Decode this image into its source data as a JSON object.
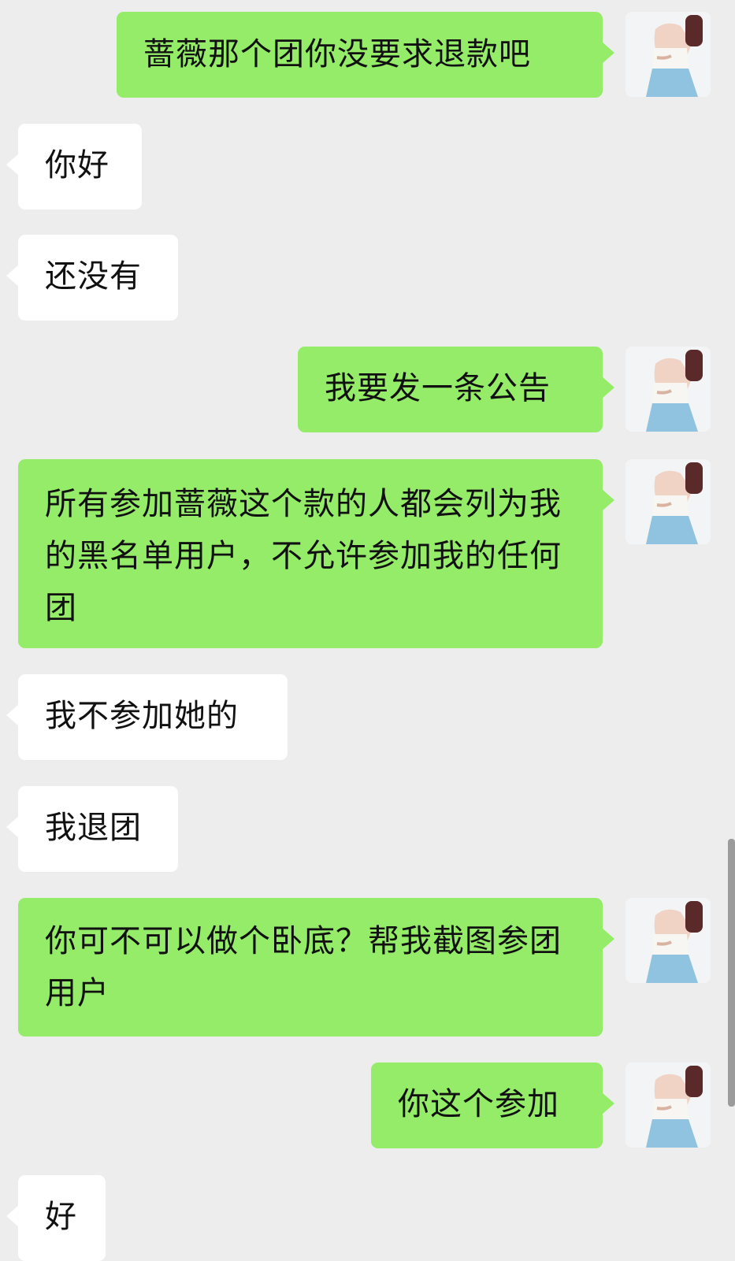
{
  "messages": [
    {
      "direction": "out",
      "text": "蔷薇那个团你没要求退款吧",
      "avatar": true
    },
    {
      "direction": "in",
      "text": "你好"
    },
    {
      "direction": "in",
      "text": "还没有"
    },
    {
      "direction": "out",
      "text": "我要发一条公告",
      "avatar": true
    },
    {
      "direction": "out",
      "text": "所有参加蔷薇这个款的人都会列为我的黑名单用户，不允许参加我的任何团",
      "avatar": true
    },
    {
      "direction": "in",
      "text": "我不参加她的"
    },
    {
      "direction": "in",
      "text": "我退团"
    },
    {
      "direction": "out",
      "text": "你可不可以做个卧底？帮我截图参团用户",
      "avatar": true
    },
    {
      "direction": "out",
      "text": "你这个参加",
      "avatar": true
    },
    {
      "direction": "in",
      "text": "好"
    }
  ],
  "colors": {
    "background": "#ededed",
    "outgoing_bubble": "#95ec69",
    "incoming_bubble": "#ffffff",
    "scrollbar": "#9b9b9b"
  },
  "avatar_icon": "user-photo-avatar"
}
